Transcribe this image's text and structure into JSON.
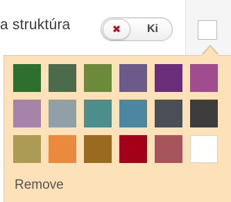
{
  "toolbar": {
    "label": "a struktúra",
    "toggle": {
      "state_text": "Ki",
      "close_glyph": "✖",
      "close_color": "#b3112c"
    }
  },
  "palette": {
    "remove_label": "Remove",
    "colors": [
      [
        "#2f6f2d",
        "#4b6b4a",
        "#6b8a3a",
        "#6b5a8a",
        "#6a2e7a",
        "#a04c8e"
      ],
      [
        "#a683a9",
        "#8fa1a7",
        "#4b8e8c",
        "#4c87a0",
        "#4a4f55",
        "#3d3d3d"
      ],
      [
        "#ab9b55",
        "#e98a3e",
        "#9a6b1f",
        "#a3001a",
        "#a6555c",
        "#ffffff"
      ]
    ]
  },
  "colors": {
    "popover_bg": "#fde1b9",
    "accent_red": "#b3112c"
  }
}
